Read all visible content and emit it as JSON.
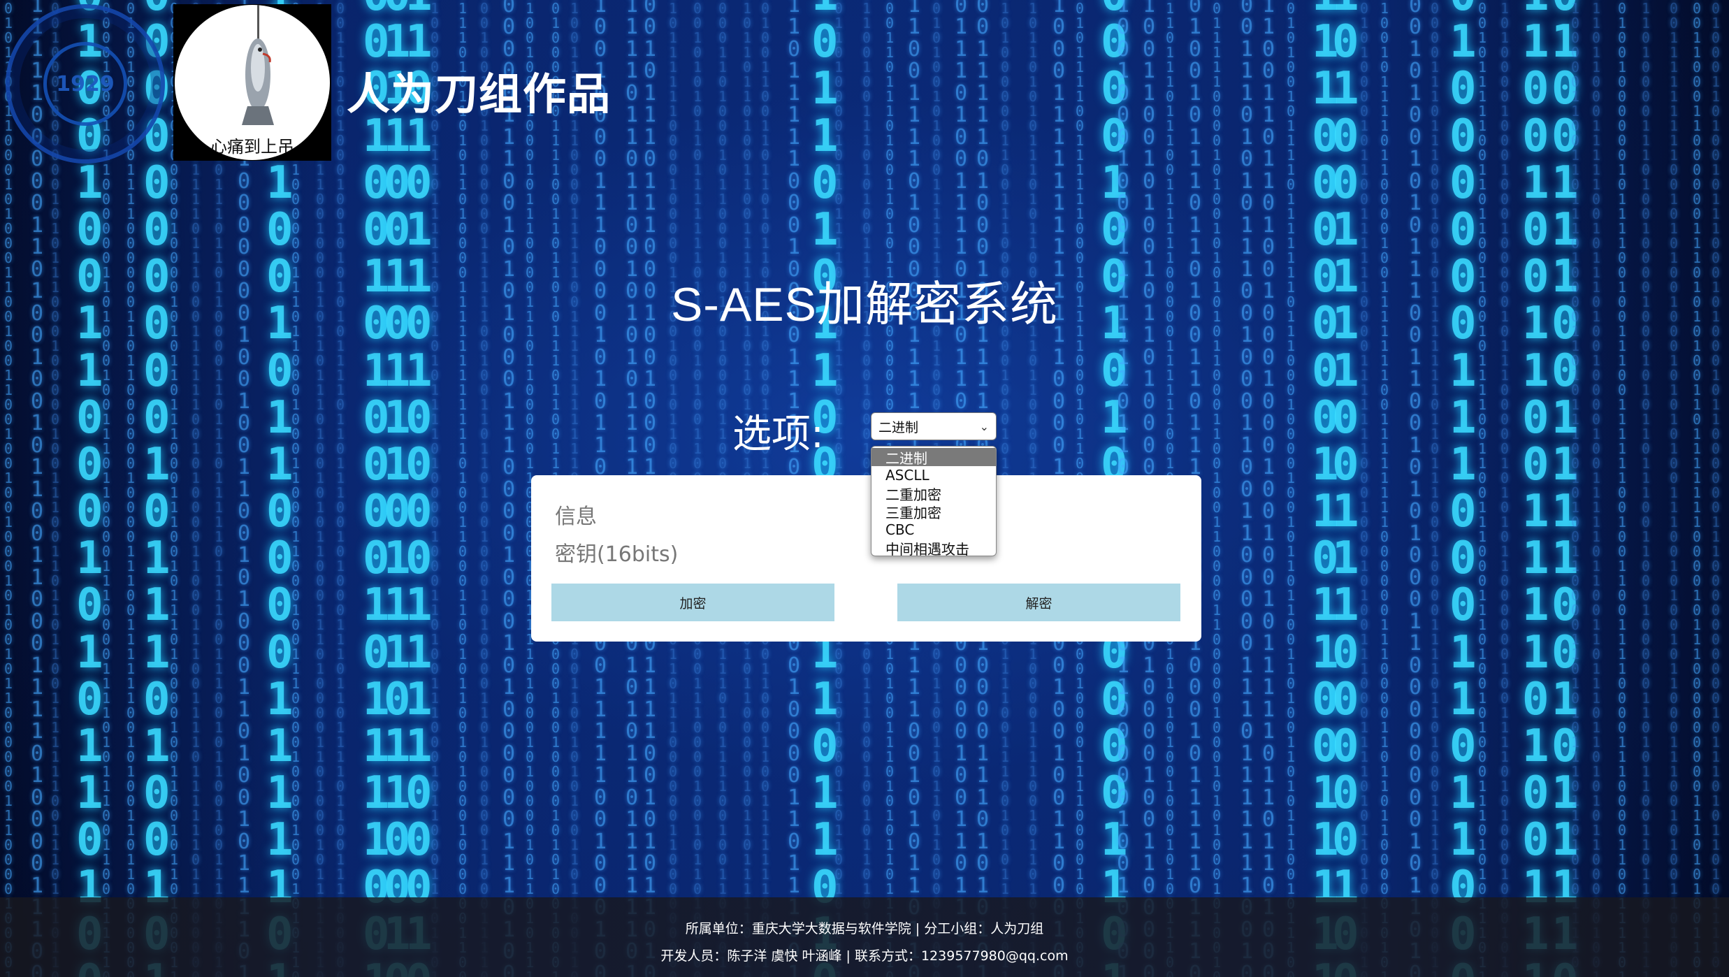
{
  "header": {
    "seal_text": "1929",
    "avatar_caption": "心痛到上吊",
    "brand": "人为刀组作品"
  },
  "main": {
    "title": "S-AES加解密系统",
    "option_label": "选项:",
    "select": {
      "value": "二进制",
      "options": [
        "二进制",
        "ASCLL",
        "二重加密",
        "三重加密",
        "CBC",
        "中间相遇攻击"
      ]
    },
    "form": {
      "message_placeholder": "信息",
      "key_placeholder": "密钥(16bits)",
      "encrypt_label": "加密",
      "decrypt_label": "解密"
    }
  },
  "footer": {
    "line1": "所属单位：重庆大学大数据与软件学院 | 分工小组：人为刀组",
    "line2": "开发人员：陈子洋 虞快 叶涵峰 | 联系方式：1239577980@qq.com"
  },
  "icons": {
    "seal": "university-seal-icon",
    "avatar": "hanging-fish-icon",
    "chevron": "chevron-down-icon"
  },
  "colors": {
    "button_bg": "#add8e6",
    "card_bg": "#ffffff",
    "footer_bg": "#19191e"
  }
}
